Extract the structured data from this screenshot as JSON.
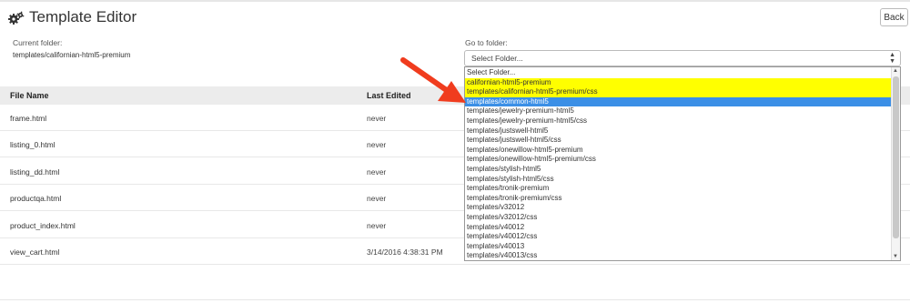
{
  "header": {
    "title": "Template Editor",
    "back_label": "Back"
  },
  "current_folder": {
    "label": "Current folder:",
    "value": "templates/californian-html5-premium"
  },
  "goto_folder": {
    "label": "Go to folder:",
    "selected": "Select Folder...",
    "options": [
      "Select Folder...",
      "californian-html5-premium",
      "templates/californian-html5-premium/css",
      "templates/common-html5",
      "templates/jewelry-premium-html5",
      "templates/jewelry-premium-html5/css",
      "templates/justswell-html5",
      "templates/justswell-html5/css",
      "templates/onewillow-html5-premium",
      "templates/onewillow-html5-premium/css",
      "templates/stylish-html5",
      "templates/stylish-html5/css",
      "templates/tronik-premium",
      "templates/tronik-premium/css",
      "templates/v32012",
      "templates/v32012/css",
      "templates/v40012",
      "templates/v40012/css",
      "templates/v40013",
      "templates/v40013/css"
    ],
    "highlight_colors": {
      "yellow": "#ffff00",
      "blue": "#3b8fe6"
    }
  },
  "table": {
    "columns": [
      "File Name",
      "Last Edited"
    ],
    "rows": [
      {
        "file": "frame.html",
        "edited": "never"
      },
      {
        "file": "listing_0.html",
        "edited": "never"
      },
      {
        "file": "listing_dd.html",
        "edited": "never"
      },
      {
        "file": "productqa.html",
        "edited": "never"
      },
      {
        "file": "product_index.html",
        "edited": "never"
      },
      {
        "file": "view_cart.html",
        "edited": "3/14/2016 4:38:31 PM"
      }
    ]
  },
  "annotation": {
    "arrow_color": "#f03c1e"
  }
}
